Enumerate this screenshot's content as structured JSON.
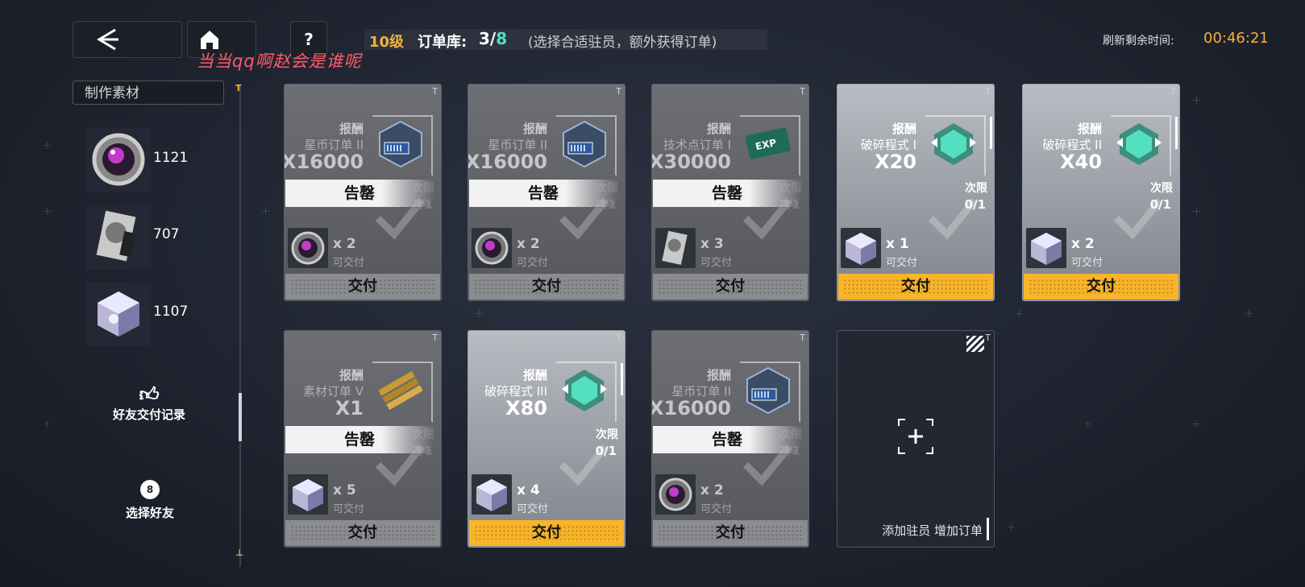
{
  "header": {
    "level": "10级",
    "library_label": "订单库:",
    "count_current": "3",
    "count_sep": "/",
    "count_total": "8",
    "hint": "(选择合适驻员，额外获得订单)",
    "refresh_label": "刷新剩余时间:",
    "refresh_time": "00:46:21",
    "watermark": "当当qq啊赵会是谁呢"
  },
  "sidebar": {
    "title": "制作素材",
    "materials": [
      {
        "name": "crystal-orb",
        "count": "1121"
      },
      {
        "name": "data-drive",
        "count": "707"
      },
      {
        "name": "prism-cube",
        "count": "1107"
      }
    ],
    "friend_records_label": "好友交付记录",
    "select_friend_label": "选择好友"
  },
  "common": {
    "reward_label": "报酬",
    "soldout_label": "告罄",
    "submit_label": "交付",
    "deliverable_label": "可交付",
    "limit_label": "次限",
    "add_resident_label": "添加驻员 增加订单"
  },
  "cards": [
    {
      "reward_name": "星币订单 II",
      "reward_qty": "X16000",
      "limit": "1/1",
      "req_qty": "x 2",
      "status": "soldout"
    },
    {
      "reward_name": "星币订单 II",
      "reward_qty": "X16000",
      "limit": "1/1",
      "req_qty": "x 2",
      "status": "soldout"
    },
    {
      "reward_name": "技术点订单 I",
      "reward_qty": "X30000",
      "limit": "1/1",
      "req_qty": "x 3",
      "status": "soldout"
    },
    {
      "reward_name": "破碎程式 I",
      "reward_qty": "X20",
      "limit": "0/1",
      "req_qty": "x 1",
      "status": "available"
    },
    {
      "reward_name": "破碎程式 II",
      "reward_qty": "X40",
      "limit": "0/1",
      "req_qty": "x 2",
      "status": "available"
    },
    {
      "reward_name": "素材订单 V",
      "reward_qty": "X1",
      "limit": "1/1",
      "req_qty": "x 5",
      "status": "soldout"
    },
    {
      "reward_name": "破碎程式 III",
      "reward_qty": "X80",
      "limit": "0/1",
      "req_qty": "x 4",
      "status": "available"
    },
    {
      "reward_name": "星币订单 II",
      "reward_qty": "X16000",
      "limit": "1/1",
      "req_qty": "x 2",
      "status": "soldout"
    }
  ],
  "colors": {
    "accent": "#f8b52a",
    "count_total": "#4fe0c0",
    "watermark": "#ff5a6a"
  }
}
